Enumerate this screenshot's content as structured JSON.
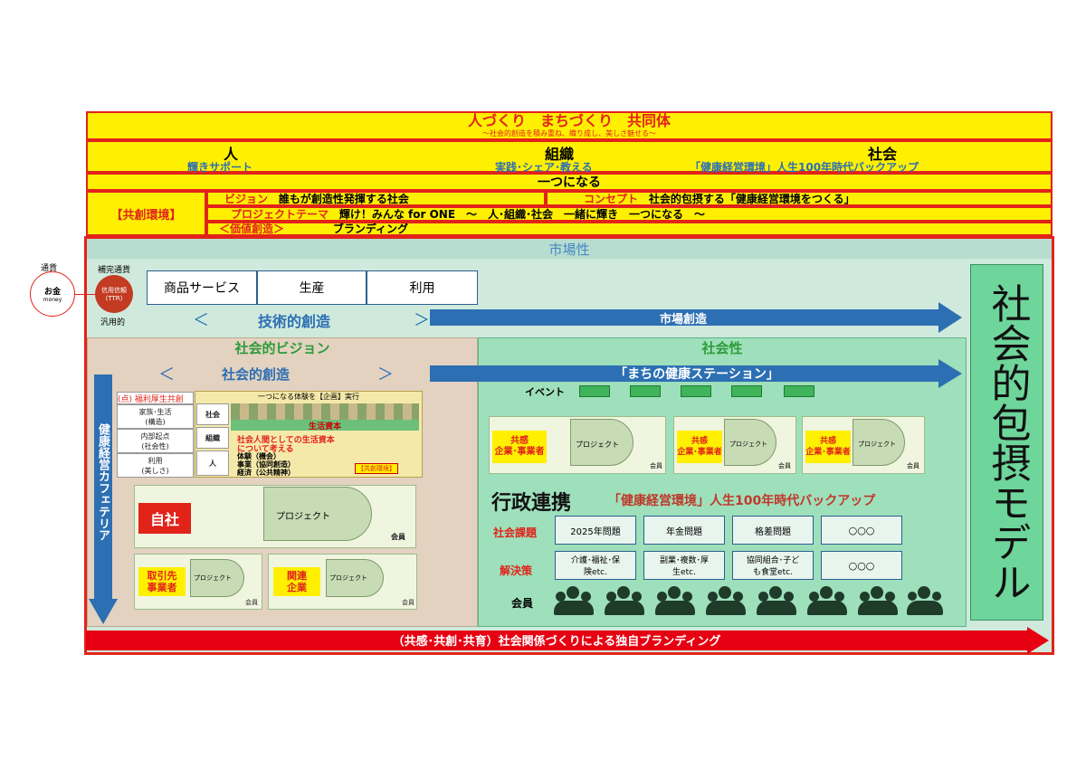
{
  "header": {
    "title": "人づくり　まちづくり　共同体",
    "subtitle": "～社会的創造を積み重ね、織り成し、美しさ魅せる～",
    "col_person": "人",
    "col_org": "組織",
    "col_society": "社会",
    "support_person": "輝きサポート",
    "support_org": "実践･シェア･教える",
    "support_society": "「健康経営環境」人生100年時代バックアップ",
    "unite": "一つになる",
    "env_label": "【共創環境】",
    "vision_key": "ビジョン",
    "vision_text": "誰もが創造性発揮する社会",
    "concept_key": "コンセプト",
    "concept_text": "社会的包摂する「健康経営環境をつくる」",
    "theme_key": "プロジェクトテーマ",
    "theme_text": "輝け！みんな for ONE　～　人･組織･社会　一緒に輝き　一つになる　～",
    "value_key": "＜価値創造＞",
    "value_text": "ブランディング"
  },
  "market": {
    "title": "市場性",
    "cells": [
      "商品サービス",
      "生産",
      "利用"
    ],
    "tech_creation": "技術的創造",
    "bracket_l": "＜",
    "bracket_r": "＞",
    "market_creation": "市場創造"
  },
  "money": {
    "currency": "通貨",
    "money_jp": "お金",
    "money_en": "money",
    "complement": "補完通貨",
    "trust": "信用信頼",
    "ttr": "(TTR)",
    "general": "汎用的"
  },
  "model": {
    "text": "社会的包摂モデル"
  },
  "social_vision": {
    "title": "社会的ビジョン",
    "creation": "社会的創造",
    "vertical": "健康経営カフェテリア",
    "points_header": "(点) 福利厚生共創",
    "points": [
      "家族･生活\n(構造)",
      "内部起点\n(社会性)",
      "利用\n(美しさ)"
    ],
    "exp_header": "一つになる体験を【企画】実行",
    "rows": [
      "社会",
      "組織",
      "人"
    ],
    "life_capital": "生活資本",
    "life_text_1": "社会人間としての生活資本",
    "life_text_2": "について考える",
    "life_text_3": "体験（機会）",
    "life_text_4": "事業（協同創造）",
    "life_text_5": "経済（公共精神）",
    "env_badge": "【共創環境】",
    "company_self": "自社",
    "company_trade": "取引先\n事業者",
    "company_related": "関連\n企業",
    "project": "プロジェクト",
    "member": "会員"
  },
  "sociality": {
    "title": "社会性",
    "station": "「まちの健康ステーション」",
    "event": "イベント",
    "partner": "共感\n企業･事業者",
    "project": "プロジェクト",
    "member": "会員",
    "admin": "行政連携",
    "admin_sub": "「健康経営環境」人生100年時代バックアップ",
    "issues_label": "社会課題",
    "issues": [
      "2025年問題",
      "年金問題",
      "格差問題",
      "○○○"
    ],
    "solutions_label": "解決策",
    "solutions": [
      "介護･福祉･保\n険etc.",
      "副業･複数･厚\n生etc.",
      "協同組合･子ど\nも食堂etc.",
      "○○○"
    ],
    "members_label": "会員"
  },
  "branding": {
    "text": "（共感･共創･共育）社会関係づくりによる独自ブランディング"
  },
  "colors": {
    "yellow": "#ffef00",
    "red": "#e2231a",
    "blue_arrow": "#2c6fb3",
    "mint": "#cfeadd",
    "tan": "#e3d2c0",
    "green_text": "#2e9b3a"
  }
}
